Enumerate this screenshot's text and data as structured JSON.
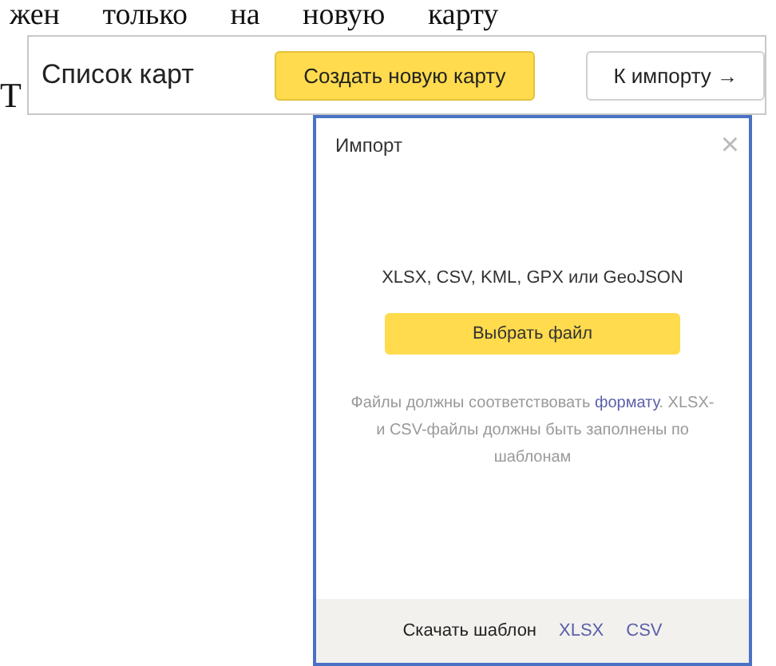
{
  "document_text": {
    "top_line": "жен только на новую карту",
    "side_letter": "Т"
  },
  "toolbar": {
    "title": "Список карт",
    "buttons": [
      {
        "label": "Создать новую карту",
        "kind": "primary"
      },
      {
        "label": "К импорту →",
        "kind": "secondary"
      }
    ]
  },
  "dialog": {
    "title": "Импорт",
    "close": "×",
    "formats": "XLSX, CSV, KML, GPX или GeoJSON",
    "choose_button": "Выбрать файл",
    "note": {
      "before": "Файлы должны соответствовать ",
      "link": "формату",
      "after": ". XLSX- и CSV-файлы должны быть заполнены по шаблонам"
    },
    "footer": {
      "label": "Скачать шаблон",
      "links": [
        "XLSX",
        "CSV"
      ]
    }
  }
}
